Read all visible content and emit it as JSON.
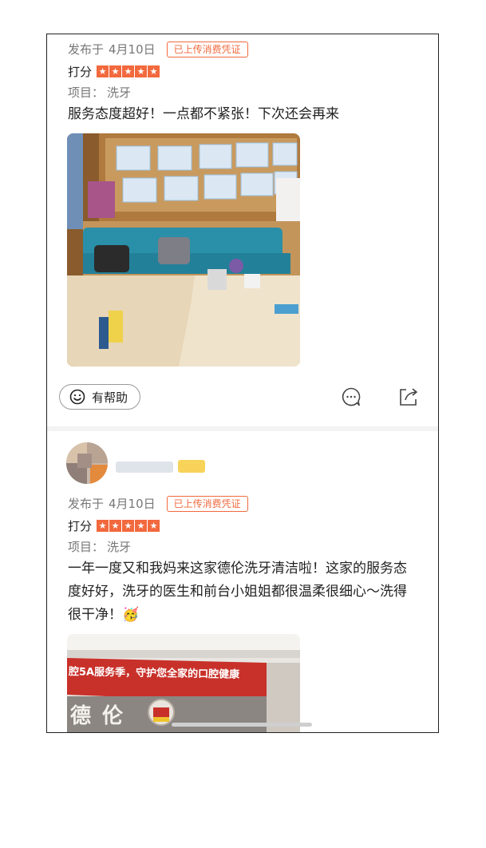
{
  "reviews": [
    {
      "date_prefix": "发布于",
      "date": "4月10日",
      "badge": "已上传消费凭证",
      "rating_label": "打分",
      "stars": 5,
      "project_label": "项目：",
      "project": "洗牙",
      "content": "服务态度超好！一点都不紧张！下次还会再来",
      "helpful_label": "有帮助",
      "photo_icon": "waiting-room-photo"
    },
    {
      "date_prefix": "发布于",
      "date": "4月10日",
      "badge": "已上传消费凭证",
      "rating_label": "打分",
      "stars": 5,
      "project_label": "项目：",
      "project": "洗牙",
      "content": "一年一度又和我妈来这家德伦洗牙清洁啦！这家的服务态度好好，洗牙的医生和前台小姐姐都很温柔很细心～洗得很干净！🥳",
      "photo_banner_text": "腔5A服务季，守护您全家的口腔健康",
      "photo_logo_text": "德伦",
      "photo_icon": "clinic-entrance-photo"
    }
  ],
  "icons": {
    "helpful": "smile-icon",
    "comment": "comment-icon",
    "share": "share-icon"
  },
  "colors": {
    "accent": "#f2693d",
    "muted_text": "#777777",
    "divider": "#f3f3f3"
  }
}
